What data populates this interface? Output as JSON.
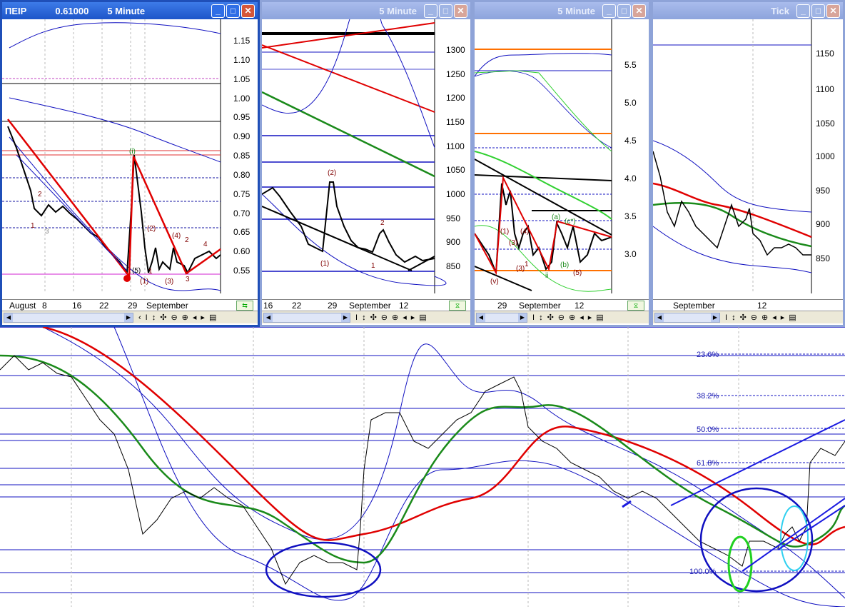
{
  "windows": [
    {
      "title_symbol": "ΠΕΙΡ",
      "title_value": "0.61000",
      "interval": "5 Minute",
      "y_ticks": [
        "1.15",
        "1.10",
        "1.05",
        "1.00",
        "0.95",
        "0.90",
        "0.85",
        "0.80",
        "0.75",
        "0.70",
        "0.65",
        "0.60",
        "0.55"
      ],
      "time_labels": [
        "August",
        "8",
        "16",
        "22",
        "29",
        "September"
      ],
      "wave_labels": [
        "(i)",
        "(1)",
        "(2)",
        "(3)",
        "(4)",
        "(5)",
        "2",
        "2",
        "4",
        "1",
        "3",
        "1",
        "3"
      ]
    },
    {
      "interval": "5 Minute",
      "y_ticks": [
        "1300",
        "1250",
        "1200",
        "1150",
        "1100",
        "1050",
        "1000",
        "950",
        "900",
        "850"
      ],
      "time_labels": [
        "16",
        "22",
        "29",
        "September",
        "12"
      ],
      "wave_labels": [
        "(2)",
        "(1)",
        "2",
        "1"
      ]
    },
    {
      "interval": "5 Minute",
      "y_ticks": [
        "5.5",
        "5.0",
        "4.5",
        "4.0",
        "3.5",
        "3.0"
      ],
      "time_labels": [
        "29",
        "September",
        "12"
      ],
      "wave_labels": [
        "(1)",
        "(3)",
        "(4)",
        "(5)",
        "(v)",
        "ii",
        "(a)",
        "(b)",
        "(c*)",
        "(3)",
        "1"
      ]
    },
    {
      "interval": "Tick",
      "y_ticks": [
        "1150",
        "1100",
        "1050",
        "1000",
        "950",
        "900",
        "850"
      ],
      "time_labels": [
        "September",
        "12"
      ]
    }
  ],
  "navbar_icons": [
    "‹",
    "›",
    "↕",
    "I",
    "↕",
    "✣",
    "⊖",
    "⊕",
    "◂",
    "▸",
    "▤"
  ],
  "main_chart": {
    "fib_levels": [
      "23.6%",
      "38.2%",
      "50.0%",
      "61.8%",
      "100.0%"
    ]
  },
  "colors": {
    "price": "#000000",
    "ma_fast": "#1a8a1a",
    "ma_slow": "#e00000",
    "bands": "#1010c0",
    "trend": "#1a1ae0",
    "title_active": "#1d55c9",
    "title_inactive": "#8da4dc"
  }
}
